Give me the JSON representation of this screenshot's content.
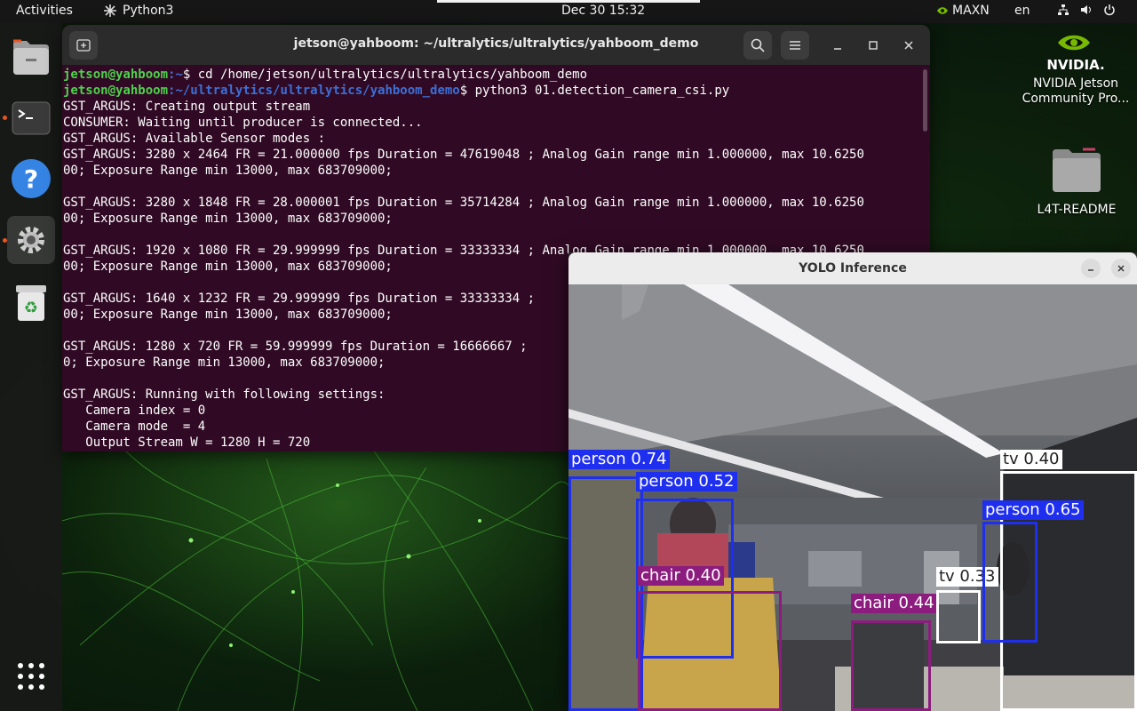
{
  "topbar": {
    "activities": "Activities",
    "app_name": "Python3",
    "clock": "Dec 30  15:32",
    "power_mode": "MAXN",
    "language": "en"
  },
  "dock": {
    "items": [
      "files-icon",
      "terminal-icon",
      "help-icon",
      "settings-icon",
      "trash-icon",
      "app-grid-icon"
    ]
  },
  "terminal": {
    "title": "jetson@yahboom: ~/ultralytics/ultralytics/yahboom_demo",
    "lines": [
      {
        "user": "jetson@yahboom",
        "path": ":~",
        "cmd": "$ cd /home/jetson/ultralytics/ultralytics/yahboom_demo"
      },
      {
        "user": "jetson@yahboom",
        "path": ":~/ultralytics/ultralytics/yahboom_demo",
        "cmd": "$ python3 01.detection_camera_csi.py"
      },
      {
        "text": "GST_ARGUS: Creating output stream"
      },
      {
        "text": "CONSUMER: Waiting until producer is connected..."
      },
      {
        "text": "GST_ARGUS: Available Sensor modes :"
      },
      {
        "text": "GST_ARGUS: 3280 x 2464 FR = 21.000000 fps Duration = 47619048 ; Analog Gain range min 1.000000, max 10.6250"
      },
      {
        "text": "00; Exposure Range min 13000, max 683709000;"
      },
      {
        "text": ""
      },
      {
        "text": "GST_ARGUS: 3280 x 1848 FR = 28.000001 fps Duration = 35714284 ; Analog Gain range min 1.000000, max 10.6250"
      },
      {
        "text": "00; Exposure Range min 13000, max 683709000;"
      },
      {
        "text": ""
      },
      {
        "text": "GST_ARGUS: 1920 x 1080 FR = 29.999999 fps Duration = 33333334 ; Analog Gain range min 1.000000, max 10.6250"
      },
      {
        "text": "00; Exposure Range min 13000, max 683709000;"
      },
      {
        "text": ""
      },
      {
        "text": "GST_ARGUS: 1640 x 1232 FR = 29.999999 fps Duration = 33333334 ;"
      },
      {
        "text": "00; Exposure Range min 13000, max 683709000;"
      },
      {
        "text": ""
      },
      {
        "text": "GST_ARGUS: 1280 x 720 FR = 59.999999 fps Duration = 16666667 ;"
      },
      {
        "text": "0; Exposure Range min 13000, max 683709000;"
      },
      {
        "text": ""
      },
      {
        "text": "GST_ARGUS: Running with following settings:"
      },
      {
        "text": "   Camera index = 0"
      },
      {
        "text": "   Camera mode  = 4"
      },
      {
        "text": "   Output Stream W = 1280 H = 720"
      }
    ]
  },
  "desktop": {
    "nvidia_logo_text": "NVIDIA.",
    "nvidia_label": "NVIDIA Jetson Community Pro...",
    "folder_label": "L4T-README"
  },
  "yolo_window": {
    "title": "YOLO Inference"
  },
  "detections": [
    {
      "label": "person 0.74",
      "class": "person",
      "color": "#1f2ff0"
    },
    {
      "label": "person 0.52",
      "class": "person",
      "color": "#1f2ff0"
    },
    {
      "label": "chair 0.40",
      "class": "chair",
      "color": "#8c1c7e"
    },
    {
      "label": "chair 0.44",
      "class": "chair",
      "color": "#8c1c7e"
    },
    {
      "label": "tv 0.33",
      "class": "tv",
      "color": "#ffffff"
    },
    {
      "label": "tv 0.40",
      "class": "tv",
      "color": "#ffffff"
    },
    {
      "label": "person 0.65",
      "class": "person",
      "color": "#1f2ff0"
    }
  ]
}
